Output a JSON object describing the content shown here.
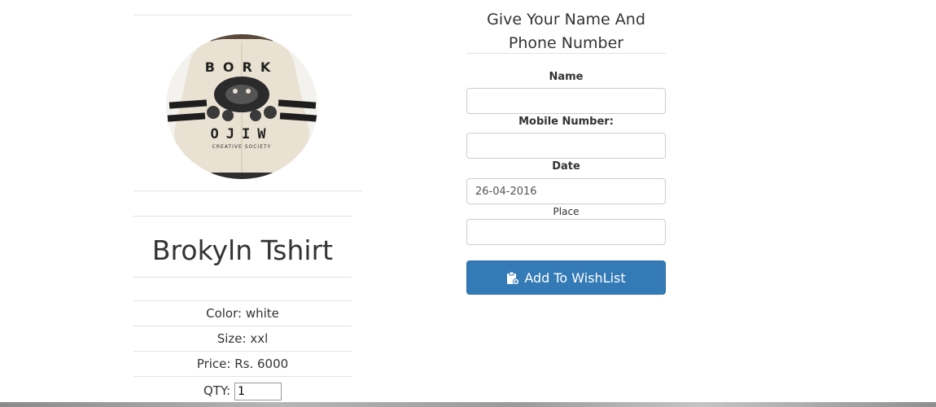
{
  "product": {
    "title": "Brokyln Tshirt",
    "color_label": "Color: white",
    "size_label": "Size: xxl",
    "price_label": "Price: Rs. 6000",
    "qty_label": "QTY:",
    "qty_value": "1",
    "image_print_top": "BORK",
    "image_print_bottom": "OJIW",
    "image_print_small": "CREATIVE SOCIETY"
  },
  "form": {
    "title": "Give Your Name And Phone Number",
    "name_label": "Name",
    "name_value": "",
    "mobile_label": "Mobile Number:",
    "mobile_value": "",
    "date_label": "Date",
    "date_value": "26-04-2016",
    "place_label": "Place",
    "place_value": "",
    "submit_label": "Add To WishList",
    "submit_icon": "clipboard-add-icon",
    "button_color": "#337ab7"
  }
}
